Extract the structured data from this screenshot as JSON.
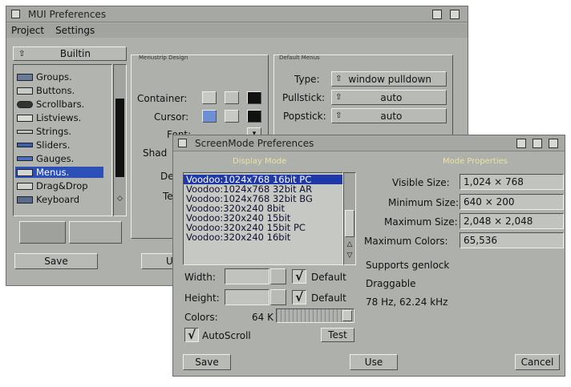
{
  "mui": {
    "title": "MUI Preferences",
    "menu": [
      "Project",
      "Settings"
    ],
    "builtin_label": "Builtin",
    "list": [
      "Groups.",
      "Buttons.",
      "Scrollbars.",
      "Listviews.",
      "Strings.",
      "Sliders.",
      "Gauges.",
      "Menus.",
      "Drag&Drop",
      "Keyboard"
    ],
    "selected_index": 7,
    "menustrip_title": "Menustrip Design",
    "container_label": "Container:",
    "cursor_label": "Cursor:",
    "font_label": "Font:",
    "shadow_label": "Shad",
    "de_label": "De",
    "te_label": "Te",
    "default_menu_title": "Default Menus",
    "type_label": "Type:",
    "type_value": "window pulldown",
    "pullstick_label": "Pullstick:",
    "pullstick_value": "auto",
    "popstick_label": "Popstick:",
    "popstick_value": "auto",
    "save_label": "Save",
    "use_label": "U"
  },
  "screenmode": {
    "title": "ScreenMode Preferences",
    "display_mode_title": "Display Mode",
    "mode_properties_title": "Mode Properties",
    "modes": [
      "Voodoo:1024x768 16bit PC",
      "Voodoo:1024x768 32bit AR",
      "Voodoo:1024x768 32bit BG",
      "Voodoo:320x240 8bit",
      "Voodoo:320x240 15bit",
      "Voodoo:320x240 15bit PC",
      "Voodoo:320x240 16bit"
    ],
    "selected_mode": 0,
    "width_label": "Width:",
    "height_label": "Height:",
    "default_label": "Default",
    "colors_label": "Colors:",
    "colors_value": "64 K",
    "autoscroll_label": "AutoScroll",
    "test_label": "Test",
    "visible_size_label": "Visible Size:",
    "visible_size": "1,024 × 768",
    "minimum_size_label": "Minimum Size:",
    "minimum_size": "640 × 200",
    "maximum_size_label": "Maximum Size:",
    "maximum_size": "2,048 × 2,048",
    "maximum_colors_label": "Maximum Colors:",
    "maximum_colors": "65,536",
    "info_lines": [
      "Supports genlock",
      "Draggable",
      "78 Hz, 62.24 kHz"
    ],
    "save_label": "Save",
    "use_label": "Use",
    "cancel_label": "Cancel"
  }
}
